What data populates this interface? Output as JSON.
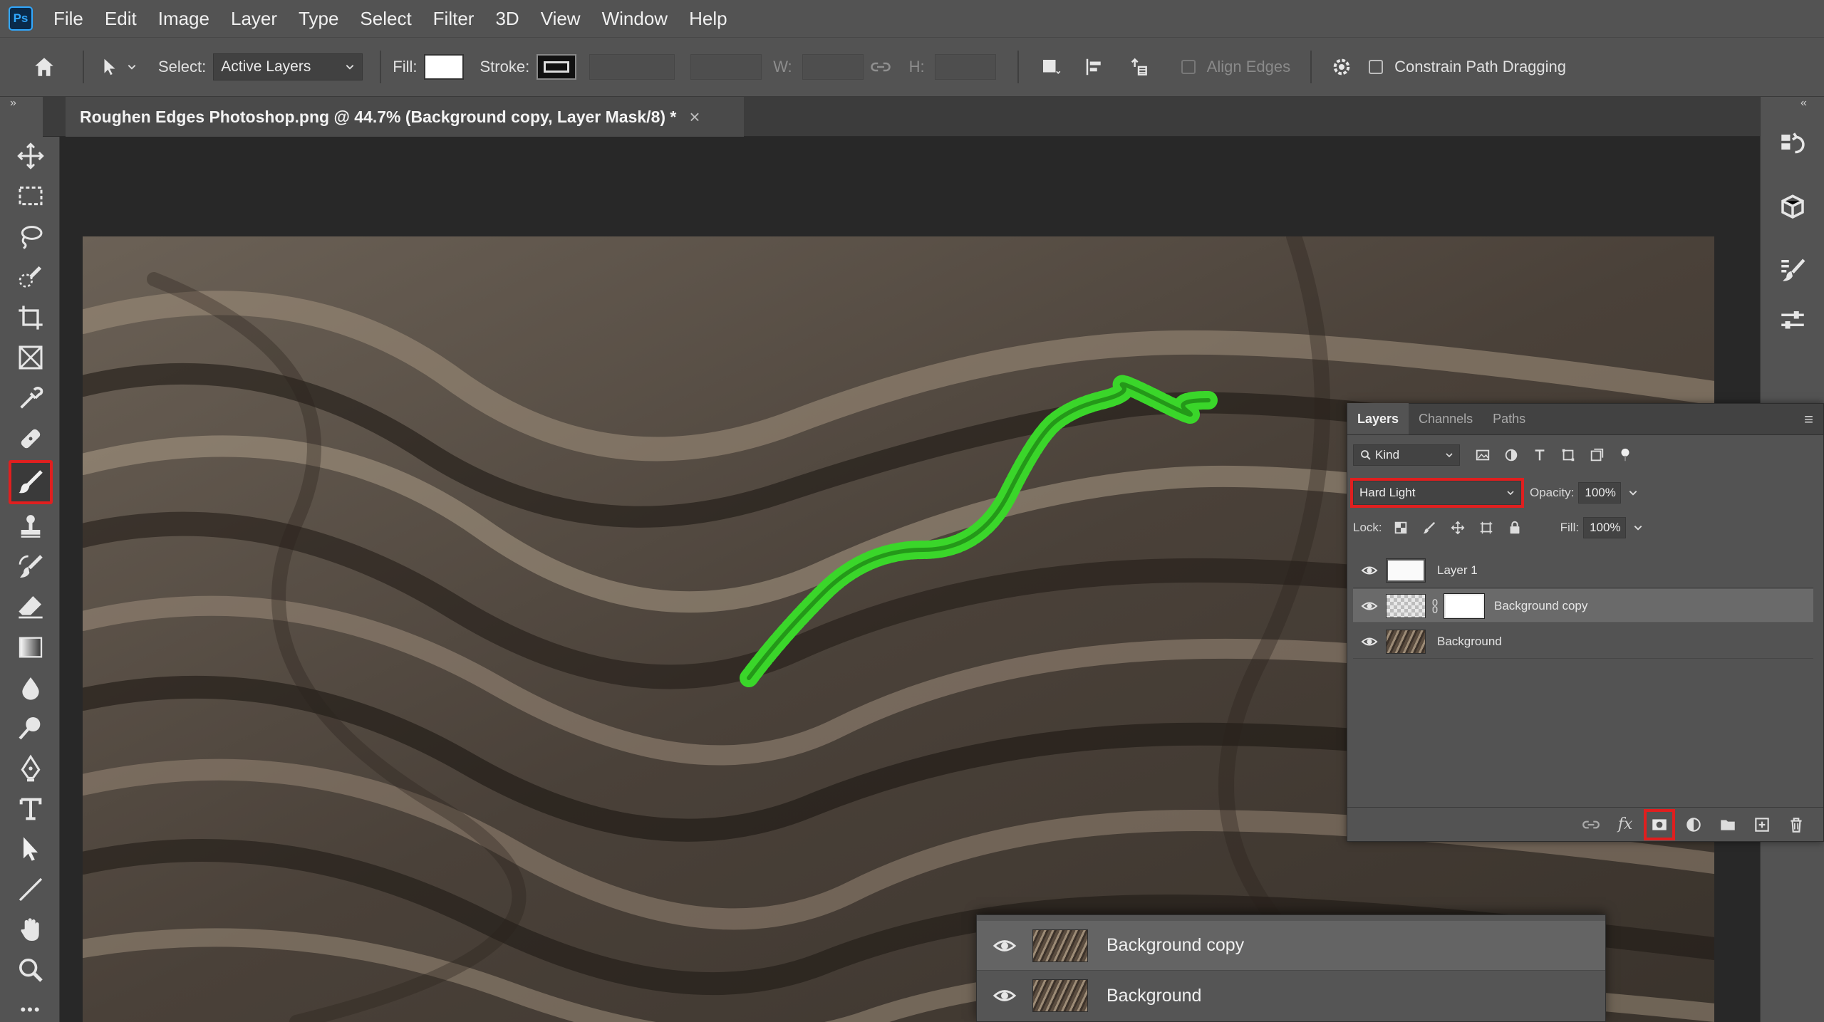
{
  "app": {
    "logo": "Ps"
  },
  "menu": [
    "File",
    "Edit",
    "Image",
    "Layer",
    "Type",
    "Select",
    "Filter",
    "3D",
    "View",
    "Window",
    "Help"
  ],
  "options": {
    "select_label": "Select:",
    "select_value": "Active Layers",
    "fill_label": "Fill:",
    "stroke_label": "Stroke:",
    "w_label": "W:",
    "h_label": "H:",
    "align_edges": "Align Edges",
    "constrain": "Constrain Path Dragging"
  },
  "document": {
    "tab_title": "Roughen Edges Photoshop.png @ 44.7% (Background copy, Layer Mask/8) *",
    "close": "×"
  },
  "panels": {
    "collapse_left": "»",
    "collapse_right": "«"
  },
  "toolbar": {
    "more": "•••"
  },
  "layers_panel": {
    "tabs": [
      "Layers",
      "Channels",
      "Paths"
    ],
    "menu": "≡",
    "kind_label": "Kind",
    "blend_mode": "Hard Light",
    "opacity_label": "Opacity:",
    "opacity_value": "100%",
    "lock_label": "Lock:",
    "fill_label": "Fill:",
    "fill_value": "100%",
    "fx_label": "fx",
    "layers": [
      {
        "name": "Layer 1"
      },
      {
        "name": "Background copy"
      },
      {
        "name": "Background"
      }
    ]
  },
  "zoom_inset": {
    "rows": [
      "Background copy",
      "Background"
    ]
  },
  "colors": {
    "highlight": "#e01f1f",
    "accent": "#31a8ff",
    "stroke_green": "#3ad62a"
  }
}
